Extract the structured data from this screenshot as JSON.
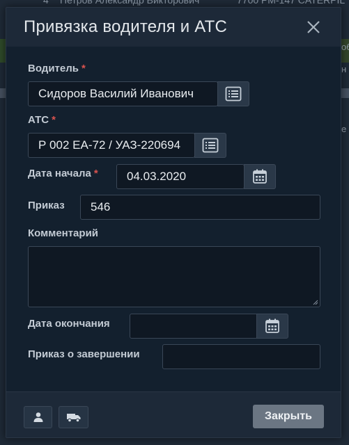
{
  "background": {
    "row_top_num": "4",
    "row_top_name": "Петров Александр Викторович",
    "row_top_vehicle": "7700 РМ-147 CATERPIL",
    "side_right_1": "об",
    "side_right_2": "н",
    "side_right_3": "е"
  },
  "modal": {
    "title": "Привязка водителя и АТС",
    "close_icon": "close-icon"
  },
  "form": {
    "driver": {
      "label": "Водитель",
      "required": "*",
      "value": "Сидоров Василий Иванович",
      "addon_icon": "list-icon"
    },
    "vehicle": {
      "label": "АТС",
      "required": "*",
      "value": "Р 002 ЕА-72 / УАЗ-220694",
      "addon_icon": "list-icon"
    },
    "start_date": {
      "label": "Дата начала",
      "required": "*",
      "value": "04.03.2020",
      "addon_icon": "calendar-icon"
    },
    "order": {
      "label": "Приказ",
      "value": "546"
    },
    "comment": {
      "label": "Комментарий",
      "value": ""
    },
    "end_date": {
      "label": "Дата окончания",
      "value": "",
      "addon_icon": "calendar-icon"
    },
    "end_order": {
      "label": "Приказ о завершении",
      "value": ""
    }
  },
  "footer": {
    "person_icon": "person-icon",
    "truck_icon": "truck-icon",
    "close_label": "Закрыть"
  },
  "colors": {
    "modal_bg": "#13202e",
    "header_bg": "#1d2938",
    "input_bg": "#0f1823",
    "required": "#d9534f",
    "button": "#6b7683"
  }
}
